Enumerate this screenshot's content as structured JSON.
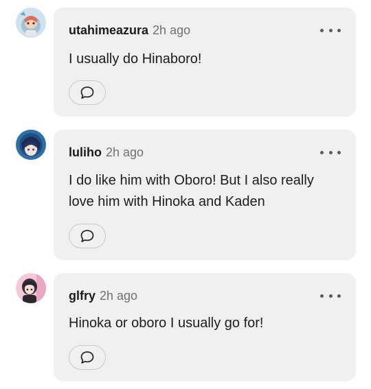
{
  "comments": [
    {
      "username": "utahimeazura",
      "time": "2h ago",
      "text": "I usually do Hinaboro!",
      "avatar_icon": "avatar-anime-character-icon",
      "more_icon": "more-horizontal-icon",
      "reply_icon": "speech-bubble-icon"
    },
    {
      "username": "luliho",
      "time": "2h ago",
      "text": "I do like him with Oboro! But I also really love him with Hinoka and Kaden",
      "avatar_icon": "avatar-anime-character-icon",
      "more_icon": "more-horizontal-icon",
      "reply_icon": "speech-bubble-icon"
    },
    {
      "username": "glfry",
      "time": "2h ago",
      "text": "Hinoka or oboro I usually go for!",
      "avatar_icon": "avatar-anime-character-icon",
      "more_icon": "more-horizontal-icon",
      "reply_icon": "speech-bubble-icon"
    }
  ],
  "colors": {
    "bubble_background": "#f0f0f1",
    "username": "#1b1b1b",
    "timestamp": "#707070",
    "text": "#1c1c1c"
  }
}
